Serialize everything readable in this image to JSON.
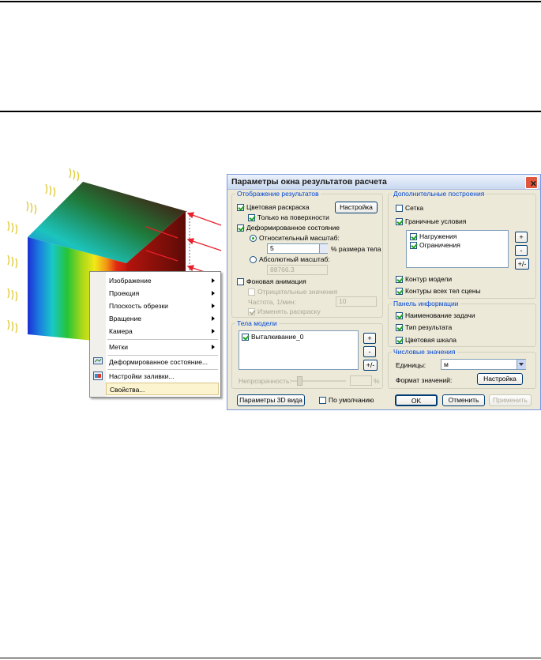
{
  "context_menu": {
    "items": [
      {
        "label": "Изображение",
        "submenu": true
      },
      {
        "label": "Проекция",
        "submenu": true
      },
      {
        "label": "Плоскость обрезки",
        "submenu": true
      },
      {
        "label": "Вращение",
        "submenu": true
      },
      {
        "label": "Камера",
        "submenu": true
      },
      {
        "label": "Метки",
        "submenu": true
      },
      {
        "label": "Деформированное состояние...",
        "icon": "deformed-state-icon"
      },
      {
        "label": "Настройки заливки...",
        "icon": "fill-settings-icon"
      },
      {
        "label": "Свойства...",
        "selected": true
      }
    ]
  },
  "dialog": {
    "title": "Параметры окна результатов расчета",
    "display_group": {
      "legend": "Отображение результатов",
      "color_fill": {
        "label": "Цветовая раскраска",
        "checked": true
      },
      "setup_button": "Настройка",
      "surface_only": {
        "label": "Только на поверхности",
        "checked": true
      },
      "deformed": {
        "label": "Деформированное состояние",
        "checked": true
      },
      "relative_scale": {
        "label": "Относительный масштаб:",
        "selected": true
      },
      "relative_value": "5",
      "relative_unit": "% размера тела",
      "absolute_scale": {
        "label": "Абсолютный масштаб:",
        "selected": false
      },
      "absolute_value": "88766.3",
      "background_anim": {
        "label": "Фоновая анимация",
        "checked": false
      },
      "negative_values": {
        "label": "Отрицательные значения",
        "checked": false
      },
      "frequency_label": "Частота, 1/мин:",
      "frequency_value": "10",
      "change_color": {
        "label": "Изменять раскраску",
        "checked": true
      }
    },
    "bodies_group": {
      "legend": "Тела модели",
      "items": [
        {
          "label": "Выталкивание_0",
          "checked": true
        }
      ],
      "btn_plus": "+",
      "btn_minus": "-",
      "btn_pm": "+/-",
      "opacity_label": "Непрозрачность:",
      "opacity_unit": "%"
    },
    "extra_group": {
      "legend": "Дополнительные построения",
      "grid": {
        "label": "Сетка",
        "checked": false
      },
      "boundary": {
        "label": "Граничные условия",
        "checked": true
      },
      "items": [
        {
          "label": "Нагружения",
          "checked": true
        },
        {
          "label": "Ограничения",
          "checked": true
        }
      ],
      "btn_plus": "+",
      "btn_minus": "-",
      "btn_pm": "+/-",
      "model_contour": {
        "label": "Контур модели",
        "checked": true
      },
      "all_contours": {
        "label": "Контуры всех тел сцены",
        "checked": true
      }
    },
    "info_group": {
      "legend": "Панель информации",
      "task_name": {
        "label": "Наименование задачи",
        "checked": true
      },
      "result_type": {
        "label": "Тип результата",
        "checked": true
      },
      "color_scale": {
        "label": "Цветовая шкала",
        "checked": true
      }
    },
    "numeric_group": {
      "legend": "Числовые значения",
      "units_label": "Единицы:",
      "units_value": "м",
      "format_label": "Формат значений:",
      "format_button": "Настройка"
    },
    "footer": {
      "view3d_button": "Параметры 3D вида",
      "default_label": "По умолчанию",
      "default_checked": false,
      "ok": "OK",
      "cancel": "Отменить",
      "apply": "Применить"
    }
  },
  "colors": {
    "dialog_bg": "#ece9d8",
    "legend_text": "#0046d5",
    "arrows": "#e8202a",
    "loads": "#e0cc3a",
    "menu_selected": "#fcf3cf"
  }
}
